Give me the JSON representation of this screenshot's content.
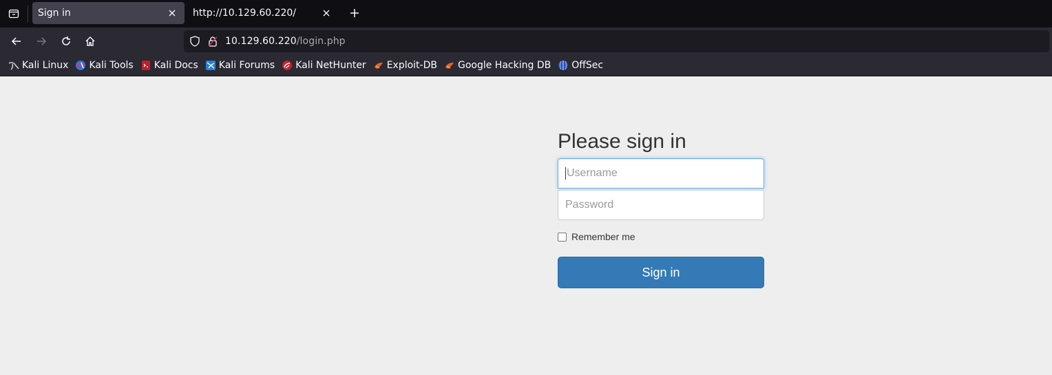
{
  "browser": {
    "tabs": [
      {
        "title": "Sign in",
        "active": true
      },
      {
        "title": "http://10.129.60.220/",
        "active": false
      }
    ],
    "url": {
      "host": "10.129.60.220",
      "path": "/login.php"
    },
    "bookmarks": [
      {
        "label": "Kali Linux",
        "icon": "kali-dragon-icon"
      },
      {
        "label": "Kali Tools",
        "icon": "kali-tools-icon"
      },
      {
        "label": "Kali Docs",
        "icon": "kali-docs-icon"
      },
      {
        "label": "Kali Forums",
        "icon": "kali-forums-icon"
      },
      {
        "label": "Kali NetHunter",
        "icon": "nethunter-icon"
      },
      {
        "label": "Exploit-DB",
        "icon": "exploit-db-icon"
      },
      {
        "label": "Google Hacking DB",
        "icon": "ghdb-icon"
      },
      {
        "label": "OffSec",
        "icon": "offsec-icon"
      }
    ]
  },
  "login": {
    "heading": "Please sign in",
    "username_placeholder": "Username",
    "password_placeholder": "Password",
    "remember_label": "Remember me",
    "submit_label": "Sign in",
    "button_color": "#337ab7"
  }
}
